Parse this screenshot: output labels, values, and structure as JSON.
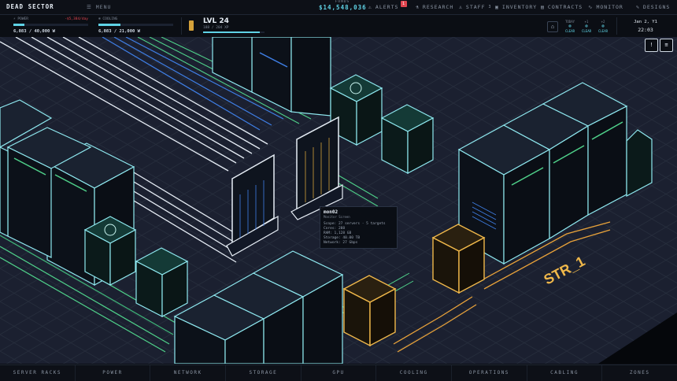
{
  "app": {
    "title": "DEAD SECTOR",
    "menu_label": "MENU"
  },
  "funds": {
    "label": "FUNDS",
    "value": "$14,548,036"
  },
  "nav": [
    {
      "label": "ALERTS",
      "icon": "warning-icon",
      "badge": "1"
    },
    {
      "label": "RESEARCH",
      "icon": "flask-icon"
    },
    {
      "label": "STAFF",
      "icon": "person-icon",
      "badge": "3"
    },
    {
      "label": "INVENTORY",
      "icon": "box-icon"
    },
    {
      "label": "CONTRACTS",
      "icon": "document-icon"
    },
    {
      "label": "MONITOR",
      "icon": "pulse-icon"
    },
    {
      "label": "DESIGNS",
      "icon": "pencil-icon"
    }
  ],
  "power": {
    "label": "POWER",
    "rate": "-$5,384/day",
    "value": "6,083 / 40,000 W",
    "fraction": 0.152
  },
  "cooling": {
    "label": "COOLING",
    "value": "6,083 / 21,000 W",
    "fraction": 0.29
  },
  "level": {
    "label": "LVL 24",
    "xp": "188 / 204 XP",
    "fraction": 0.92
  },
  "forecast": [
    {
      "day": "TODAY",
      "status": "CLEAR"
    },
    {
      "day": "+1",
      "status": "CLEAR"
    },
    {
      "day": "+2",
      "status": "CLEAR"
    }
  ],
  "clock": {
    "date": "Jan 2, Y1",
    "time": "22:03"
  },
  "side_buttons": [
    "!",
    "≡"
  ],
  "tooltip": {
    "title": "mon02",
    "subtitle": "Monitor Screen",
    "rows": [
      "Scope: 27 servers · 5 targets",
      "Cores: 288",
      "RAM: 1,128 GB",
      "Storage: 40.00 TB",
      "Network: 27 Gbps"
    ]
  },
  "floor_label": "STR_1",
  "tabs": [
    "SERVER RACKS",
    "POWER",
    "NETWORK",
    "STORAGE",
    "GPU",
    "COOLING",
    "OPERATIONS",
    "CABLING",
    "ZONES"
  ],
  "colors": {
    "accent": "#5fd3e6",
    "alert": "#e0454f",
    "gold": "#e8a23a",
    "green": "#4fd18a"
  }
}
